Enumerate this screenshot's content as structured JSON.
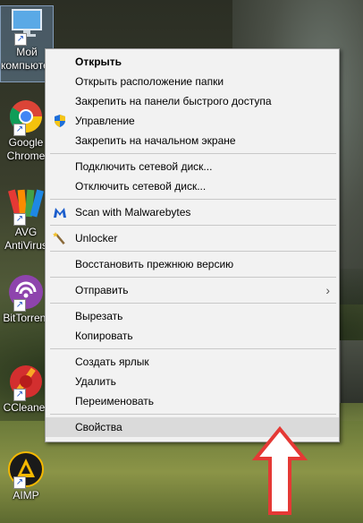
{
  "desktop_icons": [
    {
      "name": "my-computer",
      "label_line1": "Мой",
      "label_line2": "компьютер",
      "selected": true
    },
    {
      "name": "google-chrome",
      "label_line1": "Google",
      "label_line2": "Chrome"
    },
    {
      "name": "avg-antivirus",
      "label_line1": "AVG",
      "label_line2": "AntiVirus"
    },
    {
      "name": "bittorrent",
      "label_line1": "BitTorrent",
      "label_line2": ""
    },
    {
      "name": "ccleaner",
      "label_line1": "CCleaner",
      "label_line2": ""
    },
    {
      "name": "aimp",
      "label_line1": "AIMP",
      "label_line2": ""
    }
  ],
  "menu": {
    "open": "Открыть",
    "open_location": "Открыть расположение папки",
    "pin_quick": "Закрепить на панели быстрого доступа",
    "manage": "Управление",
    "pin_start": "Закрепить на начальном экране",
    "map_drive": "Подключить сетевой диск...",
    "disconnect_drive": "Отключить сетевой диск...",
    "malwarebytes": "Scan with Malwarebytes",
    "unlocker": "Unlocker",
    "restore": "Восстановить прежнюю версию",
    "send_to": "Отправить",
    "cut": "Вырезать",
    "copy": "Копировать",
    "create_shortcut": "Создать ярлык",
    "delete": "Удалить",
    "rename": "Переименовать",
    "properties": "Свойства"
  },
  "colors": {
    "menu_bg": "#f2f2f2",
    "highlight": "#dadada",
    "annotation_arrow": "#e53935"
  }
}
